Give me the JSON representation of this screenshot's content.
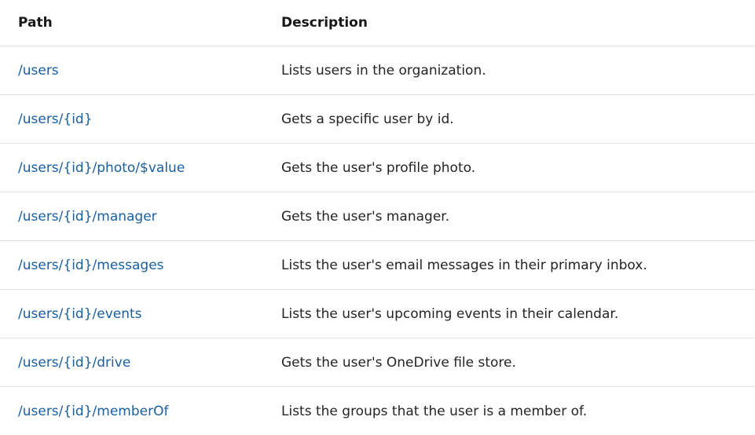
{
  "table": {
    "headers": {
      "path": "Path",
      "description": "Description"
    },
    "rows": [
      {
        "path": "/users",
        "description": "Lists users in the organization."
      },
      {
        "path": "/users/{id}",
        "description": "Gets a specific user by id."
      },
      {
        "path": "/users/{id}/photo/$value",
        "description": "Gets the user's profile photo."
      },
      {
        "path": "/users/{id}/manager",
        "description": "Gets the user's manager."
      },
      {
        "path": "/users/{id}/messages",
        "description": "Lists the user's email messages in their primary inbox."
      },
      {
        "path": "/users/{id}/events",
        "description": "Lists the user's upcoming events in their calendar."
      },
      {
        "path": "/users/{id}/drive",
        "description": "Gets the user's OneDrive file store."
      },
      {
        "path": "/users/{id}/memberOf",
        "description": "Lists the groups that the user is a member of."
      }
    ]
  },
  "colors": {
    "link": "#1a5e9e",
    "text": "#242424",
    "divider": "#e1e1e1"
  }
}
